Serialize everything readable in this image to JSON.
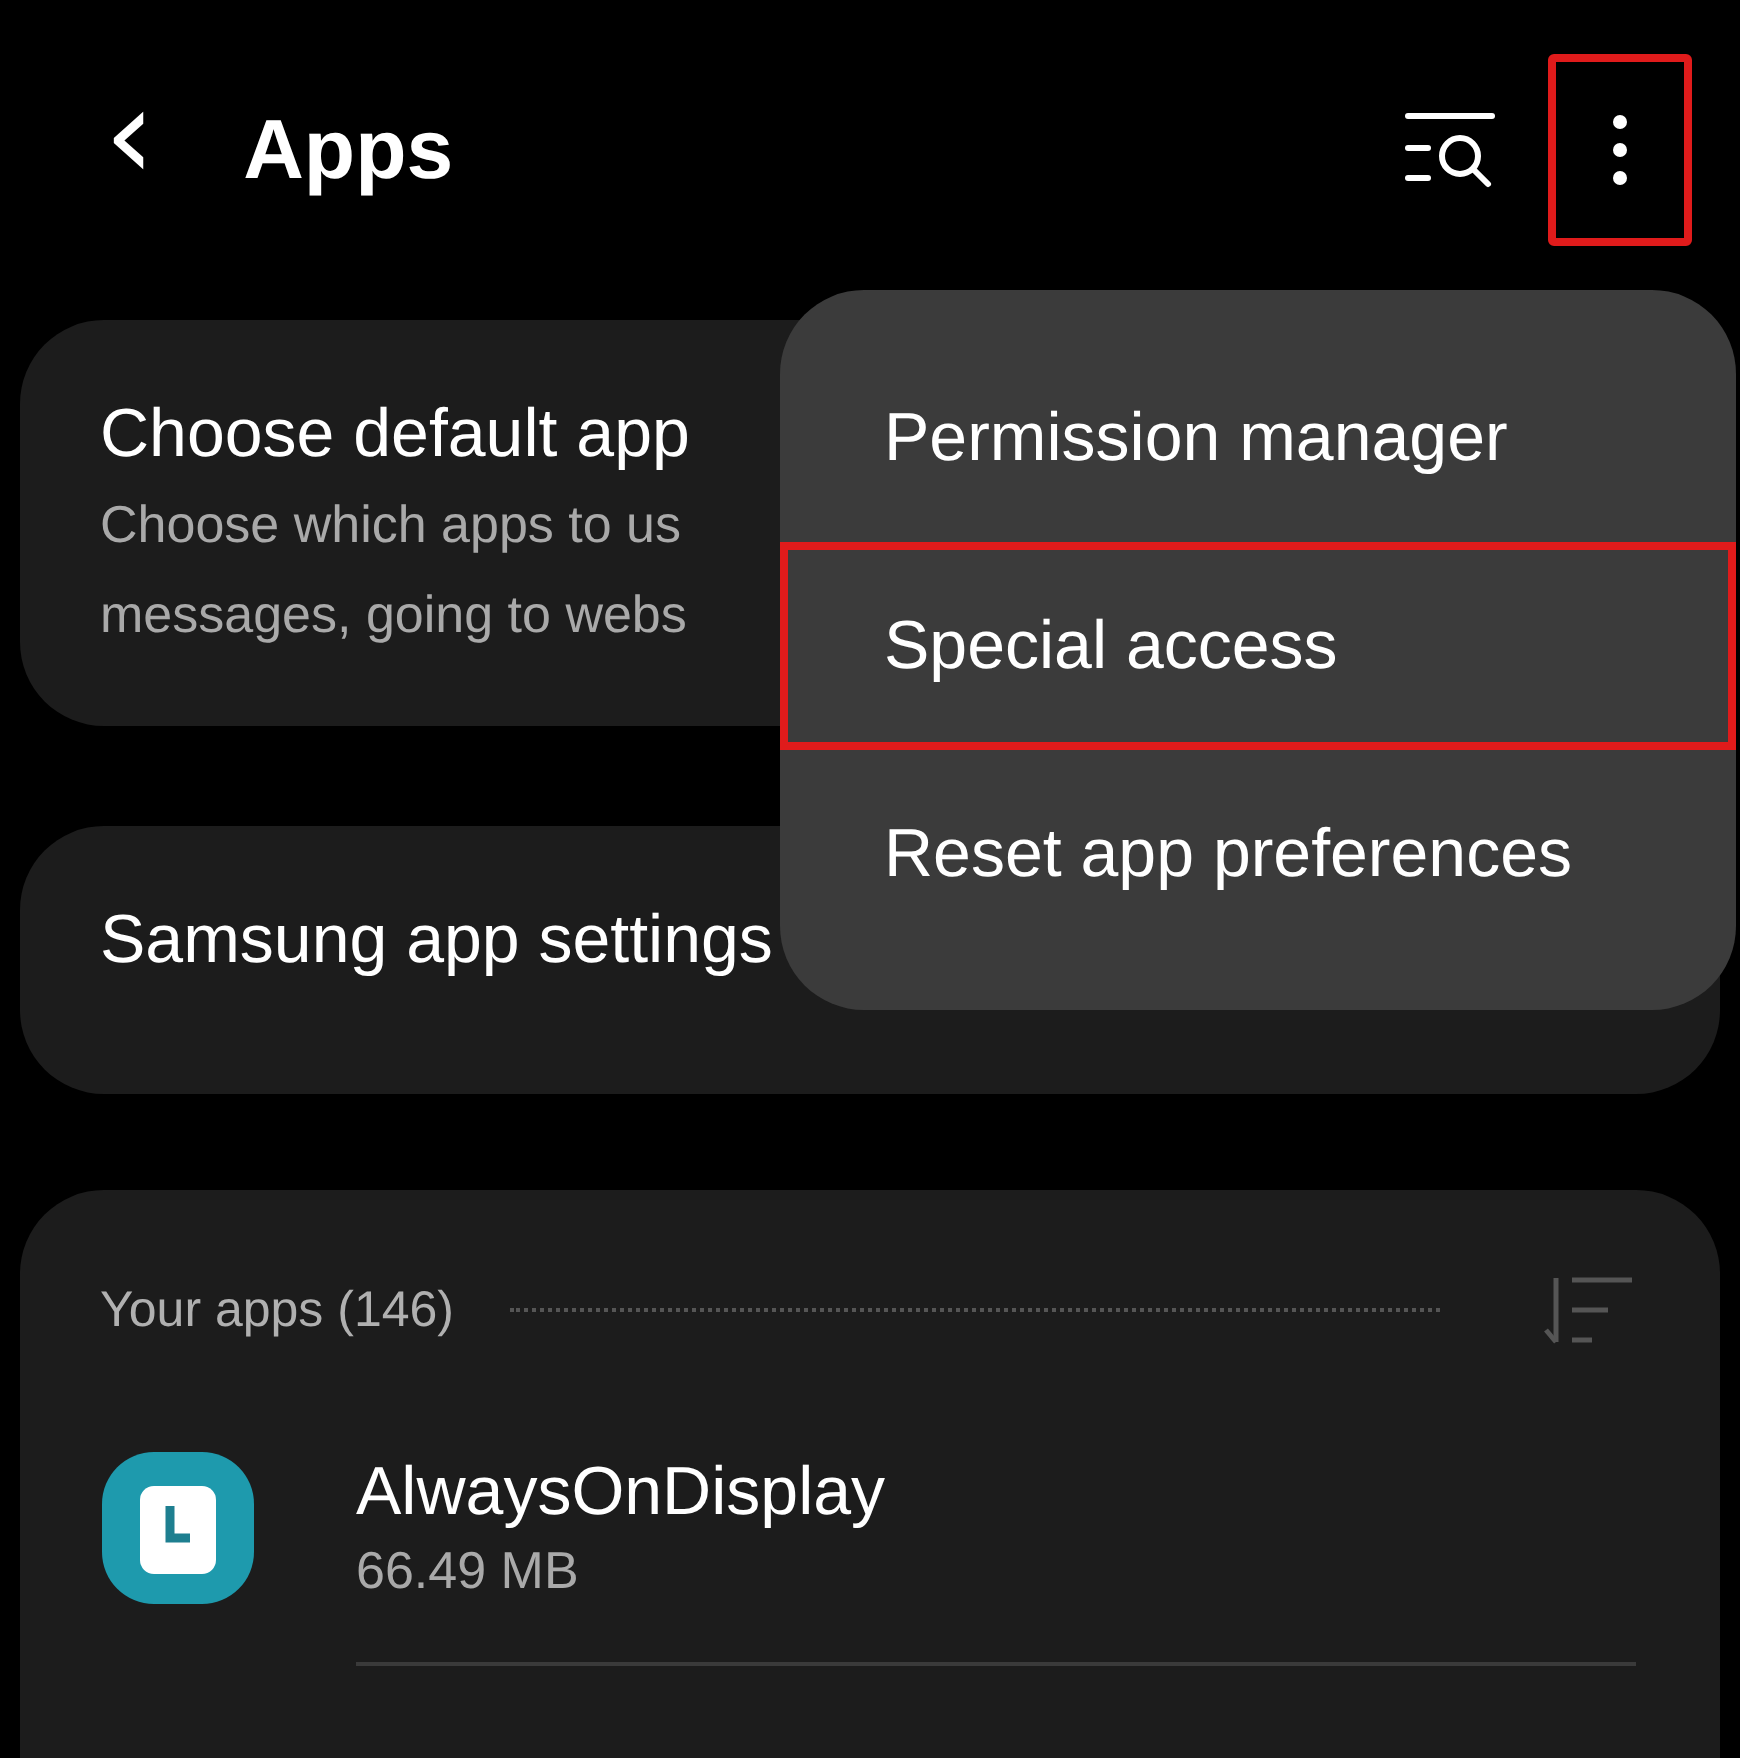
{
  "header": {
    "back": "‹",
    "title": "Apps",
    "more_highlighted": true
  },
  "cards": [
    {
      "title": "Choose default app",
      "subtitle_lines": [
        "Choose which apps to us",
        "messages, going to webs"
      ]
    },
    {
      "title": "Samsung app settings"
    }
  ],
  "apps_section": {
    "heading": "Your apps (146)",
    "apps": [
      {
        "name": "AlwaysOnDisplay",
        "size": "66.49 MB"
      }
    ]
  },
  "menu": {
    "items": [
      {
        "label": "Permission manager",
        "highlighted": false
      },
      {
        "label": "Special access",
        "highlighted": true
      },
      {
        "label": "Reset app preferences",
        "highlighted": false
      }
    ]
  }
}
